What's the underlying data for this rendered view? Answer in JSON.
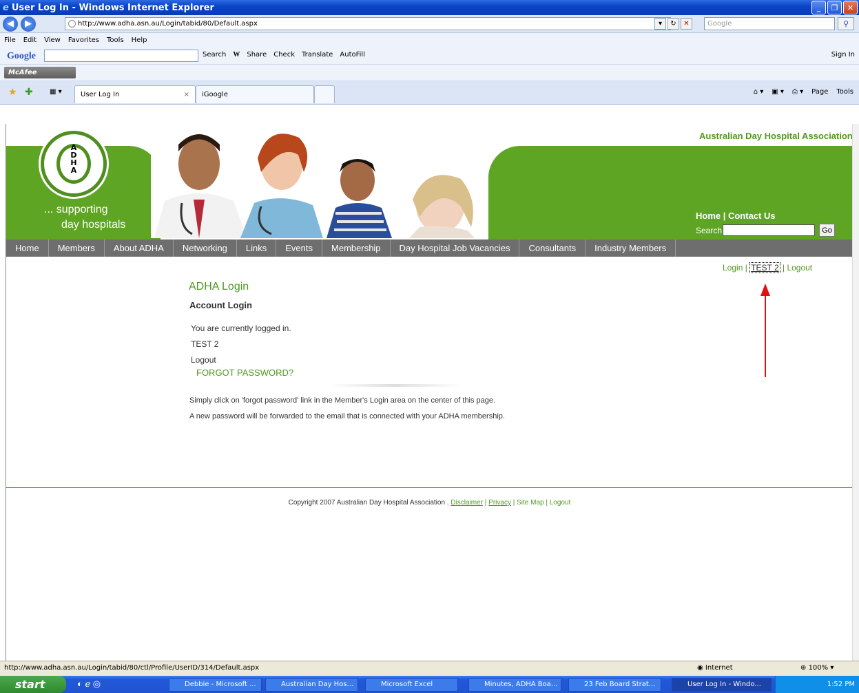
{
  "window": {
    "title": "User Log In - Windows Internet Explorer",
    "url": "http://www.adha.asn.au/Login/tabid/80/Default.aspx",
    "search_placeholder": "Google"
  },
  "menubar": [
    "File",
    "Edit",
    "View",
    "Favorites",
    "Tools",
    "Help"
  ],
  "google_toolbar": {
    "brand": "Google",
    "items": [
      "Search",
      "W",
      "Share",
      "Check",
      "Translate",
      "AutoFill"
    ],
    "sign_in": "Sign In"
  },
  "mcafee": "McAfee",
  "tabs": [
    {
      "label": "User Log In",
      "close": "×"
    },
    {
      "label": "iGoogle"
    }
  ],
  "command_bar": [
    "Page",
    "Tools"
  ],
  "site": {
    "logo_letters": "A\nD\nH\nA",
    "tagline_1": "... supporting",
    "tagline_2": "day hospitals",
    "org_name": "Australian Day Hospital Association",
    "header_links": "Home | Contact Us",
    "search_label": "Search",
    "go_button": "Go",
    "nav": [
      "Home",
      "Members",
      "About ADHA",
      "Networking",
      "Links",
      "Events",
      "Membership",
      "Day Hospital Job Vacancies",
      "Consultants",
      "Industry Members"
    ]
  },
  "user_links": {
    "login": "Login",
    "sep1": " | ",
    "user": "TEST 2",
    "sep2": " | ",
    "logout": "Logout"
  },
  "content": {
    "title": "ADHA Login",
    "subtitle": "Account Login",
    "status": "You are currently logged in.",
    "user": "TEST 2",
    "logout": "Logout",
    "forgot": "FORGOT PASSWORD?",
    "info_1": "Simply click on 'forgot password' link in the Member's Login area on the center of this page.",
    "info_2": "A new password will be forwarded to the email that is connected with your ADHA membership."
  },
  "footer": {
    "copyright": "Copyright 2007 Australian Day Hospital Association . ",
    "disclaimer": "Disclaimer",
    "sep": " | ",
    "privacy": "Privacy",
    "rest": " | Site Map | Logout"
  },
  "statusbar": {
    "link": "http://www.adha.asn.au/Login/tabid/80/ctl/Profile/UserID/314/Default.aspx",
    "zone": "Internet",
    "zoom": "100%"
  },
  "taskbar": {
    "start": "start",
    "tasks": [
      "Debbie - Microsoft ...",
      "Australian Day Hos...",
      "Microsoft Excel",
      "Minutes, ADHA Boa...",
      "23 Feb Board Strat...",
      "User Log In - Windo..."
    ],
    "clock": "1:52 PM"
  },
  "colors": {
    "brand_green": "#5fa524",
    "nav_gray": "#6e6e6e",
    "arrow_red": "#e01010"
  }
}
